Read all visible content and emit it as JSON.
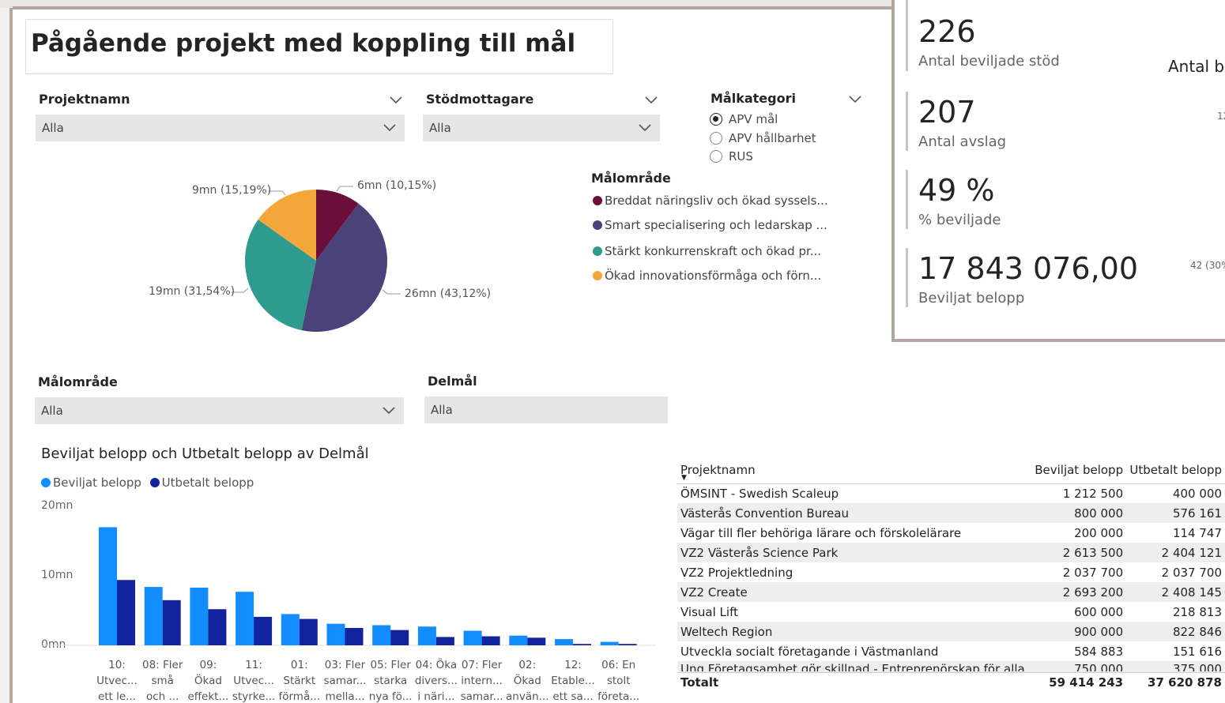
{
  "report": {
    "title": "Pågående projekt med koppling till mål"
  },
  "slicers": {
    "projektnamn": {
      "label": "Projektnamn",
      "value": "Alla"
    },
    "stodmottagare": {
      "label": "Stödmottagare",
      "value": "Alla"
    },
    "malomrade": {
      "label": "Målområde",
      "value": "Alla"
    },
    "delmal": {
      "label": "Delmål",
      "value": "Alla"
    },
    "malkategori": {
      "label": "Målkategori",
      "options": [
        "APV mål",
        "APV hållbarhet",
        "RUS"
      ],
      "selected": "APV mål"
    }
  },
  "pie": {
    "legend_title": "Målområde",
    "slices": [
      {
        "name": "Breddat näringsliv och ökad syssels...",
        "value": 6,
        "percent": 10.15,
        "label": "6mn (10,15%)",
        "color": "#6b0f3a"
      },
      {
        "name": "Smart specialisering och ledarskap ...",
        "value": 26,
        "percent": 43.12,
        "label": "26mn (43,12%)",
        "color": "#4a4278"
      },
      {
        "name": "Stärkt konkurrenskraft och ökad pr...",
        "value": 19,
        "percent": 31.54,
        "label": "19mn (31,54%)",
        "color": "#2f9a8e"
      },
      {
        "name": "Ökad innovationsförmåga och förn...",
        "value": 9,
        "percent": 15.19,
        "label": "9mn (15,19%)",
        "color": "#f3a73b"
      }
    ]
  },
  "kpis": [
    {
      "value": "226",
      "label": "Antal beviljade stöd"
    },
    {
      "value": "207",
      "label": "Antal avslag"
    },
    {
      "value": "49 %",
      "label": "% beviljade"
    },
    {
      "value": "17 843 076,00",
      "label": "Beviljat belopp"
    }
  ],
  "kpi_side": {
    "label": "Antal b",
    "tick1": "12",
    "tick2": "42 (30%"
  },
  "chart_data": {
    "type": "bar",
    "title": "Beviljat belopp och Utbetalt belopp av Delmål",
    "y_ticks": [
      "20mn",
      "10mn",
      "0mn"
    ],
    "ylim": [
      0,
      20
    ],
    "categories": [
      [
        "10:",
        "Utvec...",
        "ett le..."
      ],
      [
        "08: Fler",
        "små",
        "och ..."
      ],
      [
        "09:",
        "Ökad",
        "effekt..."
      ],
      [
        "11:",
        "Utvec...",
        "styrke..."
      ],
      [
        "01:",
        "Stärkt",
        "förmå..."
      ],
      [
        "03: Fler",
        "samar...",
        "mella..."
      ],
      [
        "05: Fler",
        "starka",
        "nya fö..."
      ],
      [
        "04: Öka",
        "divers...",
        "i näri..."
      ],
      [
        "07: Fler",
        "intern...",
        "samar..."
      ],
      [
        "02:",
        "Ökad",
        "använ..."
      ],
      [
        "12:",
        "Etable...",
        "ett sa..."
      ],
      [
        "06: En",
        "stolt",
        "företa..."
      ]
    ],
    "series": [
      {
        "name": "Beviljat belopp",
        "color": "#118dff",
        "values": [
          17.0,
          8.4,
          8.3,
          7.7,
          4.5,
          3.1,
          2.9,
          2.7,
          2.1,
          1.4,
          0.9,
          0.5
        ]
      },
      {
        "name": "Utbetalt belopp",
        "color": "#12239e",
        "values": [
          9.4,
          6.5,
          5.2,
          4.1,
          3.8,
          2.5,
          2.2,
          1.2,
          1.3,
          1.1,
          0.2,
          0.2
        ]
      }
    ]
  },
  "table": {
    "headers": [
      "Projektnamn",
      "Beviljat belopp",
      "Utbetalt belopp"
    ],
    "rows": [
      [
        "ÖMSINT - Swedish Scaleup",
        "1 212 500",
        "400 000"
      ],
      [
        "Västerås Convention Bureau",
        "800 000",
        "576 161"
      ],
      [
        "Vägar till fler behöriga lärare och förskolelärare",
        "200 000",
        "114 747"
      ],
      [
        "VZ2 Västerås Science Park",
        "2 613 500",
        "2 404 121"
      ],
      [
        "VZ2 Projektledning",
        "2 037 700",
        "2 037 700"
      ],
      [
        "VZ2 Create",
        "2 693 200",
        "2 408 145"
      ],
      [
        "Visual Lift",
        "600 000",
        "218 813"
      ],
      [
        "Weltech Region",
        "900 000",
        "822 846"
      ],
      [
        "Utveckla socialt företagande i Västmanland",
        "584 883",
        "151 616"
      ],
      [
        "Ung Företagsamhet gör skillnad - Entreprenörskap för alla",
        "750 000",
        "375 000"
      ]
    ],
    "total": [
      "Totalt",
      "59 414 243",
      "37 620 878"
    ]
  }
}
